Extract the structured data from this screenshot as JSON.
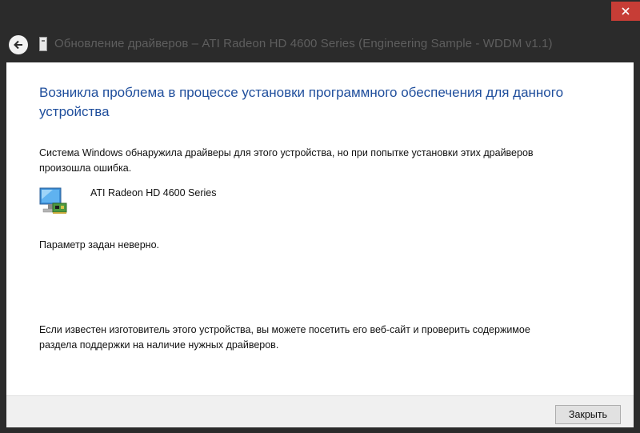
{
  "window": {
    "title": "Обновление драйверов – ATI Radeon HD 4600 Series (Engineering Sample - WDDM v1.1)"
  },
  "content": {
    "heading": "Возникла проблема в процессе установки программного обеспечения для данного устройства",
    "description": "Система Windows обнаружила драйверы для этого устройства, но при попытке установки этих драйверов произошла ошибка.",
    "device_name": "ATI Radeon HD 4600 Series",
    "device_icon": "monitor-with-card-icon",
    "error_message": "Параметр задан неверно.",
    "hint": "Если известен изготовитель этого устройства, вы можете посетить его веб-сайт и проверить содержимое раздела поддержки на наличие нужных драйверов."
  },
  "footer": {
    "close_label": "Закрыть"
  },
  "colors": {
    "titlebar": "#2b2b2b",
    "close_button": "#c73d36",
    "heading": "#1f4e9c"
  }
}
